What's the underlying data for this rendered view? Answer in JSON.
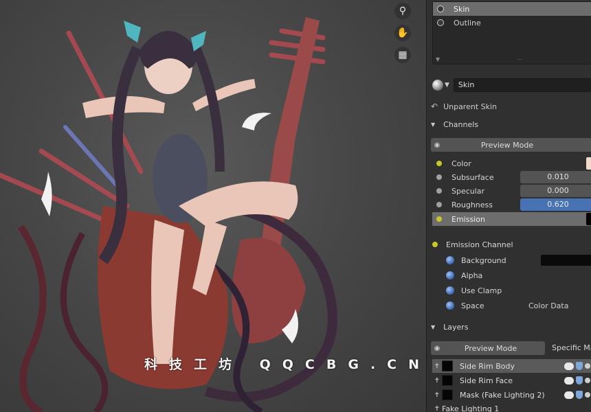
{
  "viewport": {
    "nav_icons": [
      "zoom-icon",
      "hand-pan-icon",
      "camera-icon"
    ],
    "watermark": "科技工坊 QQCBG.CN"
  },
  "shader_list": {
    "items": [
      {
        "label": "Skin",
        "selected": true
      },
      {
        "label": "Outline",
        "selected": false
      }
    ]
  },
  "material_selector": {
    "value": "Skin"
  },
  "unparent": {
    "label": "Unparent Skin"
  },
  "channels": {
    "header": "Channels",
    "preview_mode": "Preview Mode",
    "props": [
      {
        "label": "Color",
        "socket": "yellow",
        "value": null,
        "swatch": "#f1d9cc"
      },
      {
        "label": "Subsurface",
        "socket": "gray",
        "value": "0.010"
      },
      {
        "label": "Specular",
        "socket": "gray",
        "value": "0.000"
      },
      {
        "label": "Roughness",
        "socket": "gray",
        "value": "0.620",
        "active": true
      },
      {
        "label": "Emission",
        "socket": "yellow",
        "highlight": true,
        "swatch": "#050505"
      }
    ]
  },
  "emission_channel": {
    "header": "Emission Channel",
    "rows": [
      {
        "label": "Background"
      },
      {
        "label": "Alpha"
      },
      {
        "label": "Use Clamp"
      },
      {
        "label": "Space",
        "value": "Color Data"
      }
    ]
  },
  "layers": {
    "header": "Layers",
    "preview_mode": "Preview Mode",
    "specific": "Specific Ma",
    "items": [
      {
        "name": "Side Rim Body",
        "selected": true
      },
      {
        "name": "Side Rim Face",
        "selected": false
      },
      {
        "name": "Mask (Fake Lighting 2)",
        "selected": false
      },
      {
        "name": "Fake Lighting 1",
        "selected": false
      }
    ]
  },
  "colors": {
    "accent_blue": "#4772b3",
    "socket_yellow": "#c7c729",
    "panel_bg": "#303030"
  }
}
